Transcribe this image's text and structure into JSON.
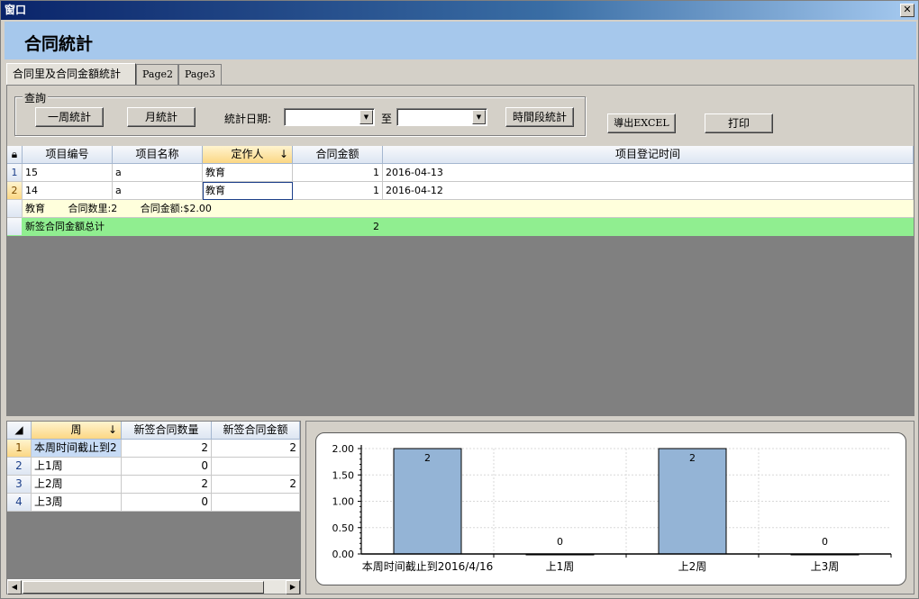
{
  "window": {
    "title": "窗口",
    "close_glyph": "✕"
  },
  "header": {
    "title": "合同統計"
  },
  "tabs": [
    {
      "label": "合同里及合同金額統計"
    },
    {
      "label": "Page2"
    },
    {
      "label": "Page3"
    }
  ],
  "query": {
    "legend": "查詢",
    "week_btn": "一周統計",
    "month_btn": "月統計",
    "date_label": "統計日期:",
    "to_label": "至",
    "period_btn": "時間段統計",
    "export_btn": "導出EXCEL",
    "print_btn": "打印",
    "date_from": "",
    "date_to": ""
  },
  "grid1": {
    "corner_icon": "lock-icon",
    "columns": [
      "项目编号",
      "项目名称",
      "定作人",
      "合同金额",
      "项目登记时间"
    ],
    "sort_glyph": "↓",
    "rows": [
      {
        "num": "1",
        "id": "15",
        "name": "a",
        "person": "教育",
        "amount": "1",
        "date": "2016-04-13"
      },
      {
        "num": "2",
        "id": "14",
        "name": "a",
        "person": "教育",
        "amount": "1",
        "date": "2016-04-12"
      }
    ],
    "group_row": {
      "person": "教育",
      "count_label": "合同数里:2",
      "amount_label": "合同金额:$2.00"
    },
    "total_row": {
      "label": "新签合同金额总计",
      "value": "2"
    }
  },
  "grid2": {
    "columns": [
      "周",
      "新签合同数量",
      "新签合同金额"
    ],
    "sort_glyph": "↓",
    "rows": [
      {
        "num": "1",
        "week": "本周时间截止到2",
        "count": "2",
        "amount": "2"
      },
      {
        "num": "2",
        "week": "上1周",
        "count": "0",
        "amount": ""
      },
      {
        "num": "3",
        "week": "上2周",
        "count": "2",
        "amount": "2"
      },
      {
        "num": "4",
        "week": "上3周",
        "count": "0",
        "amount": ""
      }
    ]
  },
  "chart_data": {
    "type": "bar",
    "categories": [
      "本周时间截止到2016/4/16",
      "上1周",
      "上2周",
      "上3周"
    ],
    "values": [
      2,
      0,
      2,
      0
    ],
    "data_labels": [
      "2",
      "0",
      "2",
      "0"
    ],
    "y_ticks": [
      "0.00",
      "0.50",
      "1.00",
      "1.50",
      "2.00"
    ],
    "ylim": [
      0,
      2
    ],
    "grid": true,
    "bar_color": "#94b4d6"
  }
}
